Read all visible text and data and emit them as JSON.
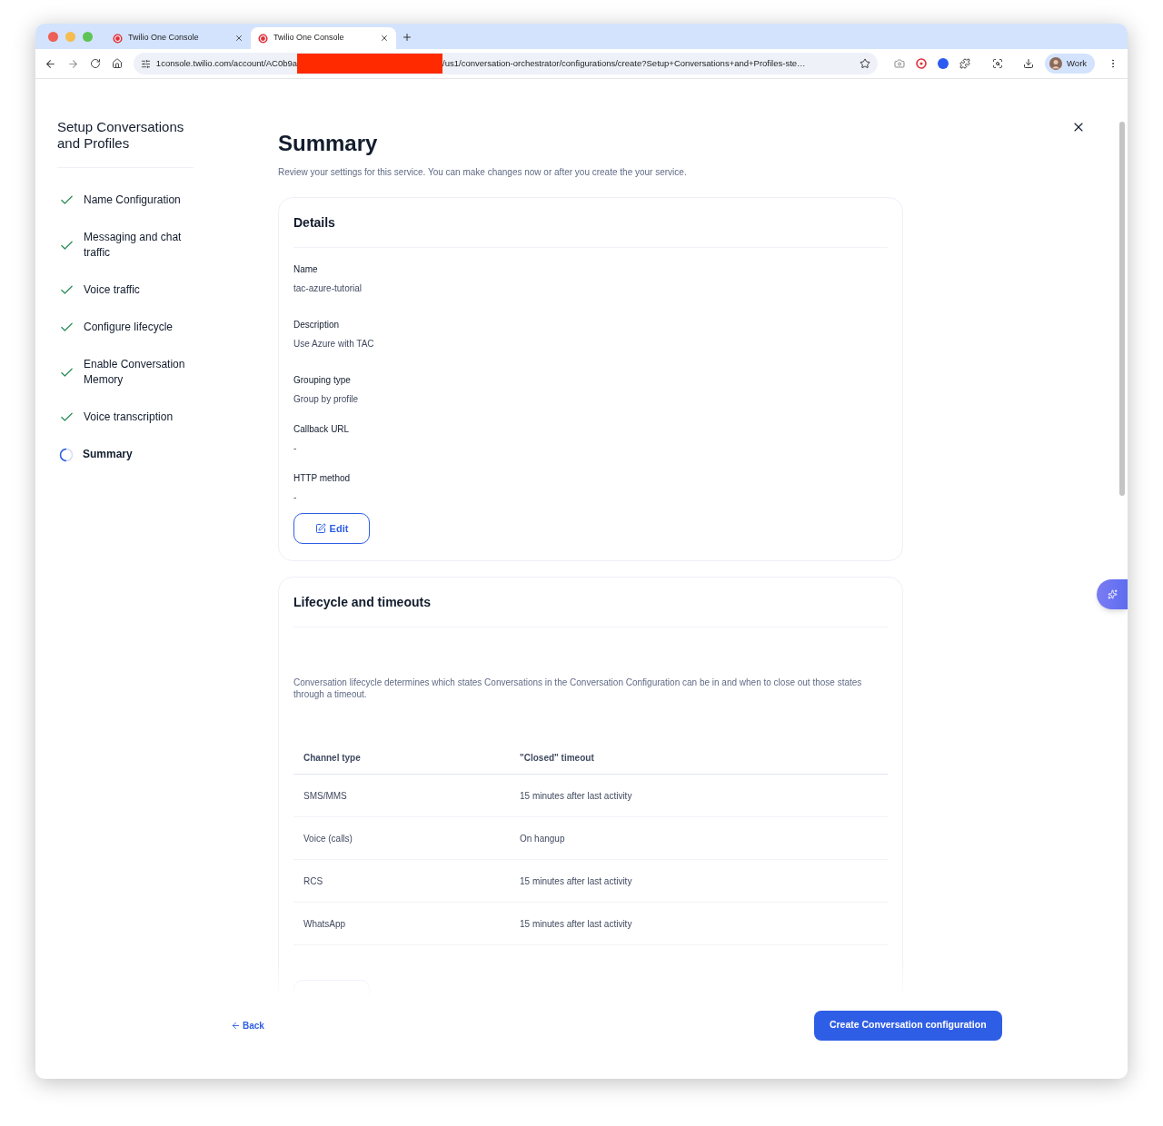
{
  "browser": {
    "tabs": [
      {
        "title": "Twilio One Console",
        "selected": false
      },
      {
        "title": "Twilio One Console",
        "selected": true
      }
    ],
    "address": {
      "before": "1console.twilio.com/account/AC0b9a",
      "after": "/us1/conversation-orchestrator/configurations/create?Setup+Conversations+and+Profiles-ste…"
    },
    "profile": "Work"
  },
  "sidebar": {
    "title": "Setup Conversations and Profiles",
    "steps": [
      {
        "label": "Name Configuration",
        "completed": true,
        "selected": false
      },
      {
        "label": "Messaging and chat traffic",
        "completed": true,
        "selected": false
      },
      {
        "label": "Voice traffic",
        "completed": true,
        "selected": false
      },
      {
        "label": "Configure lifecycle",
        "completed": true,
        "selected": false
      },
      {
        "label": "Enable Conversation Memory",
        "completed": true,
        "selected": false
      },
      {
        "label": "Voice transcription",
        "completed": true,
        "selected": false
      },
      {
        "label": "Summary",
        "completed": false,
        "selected": true
      }
    ]
  },
  "page": {
    "title": "Summary",
    "subtitle": "Review your settings for this service. You can make changes now or after you create the your service."
  },
  "details": {
    "title": "Details",
    "fields": [
      {
        "label": "Name",
        "value": "tac-azure-tutorial"
      },
      {
        "label": "Description",
        "value": "Use Azure with TAC"
      },
      {
        "label": "Grouping type",
        "value": "Group by profile"
      },
      {
        "label": "Callback URL",
        "value": "-"
      },
      {
        "label": "HTTP method",
        "value": "-"
      }
    ],
    "edit": "Edit"
  },
  "lifecycle": {
    "title": "Lifecycle and timeouts",
    "description": "Conversation lifecycle determines which states Conversations in the Conversation Configuration can be in and when to close out those states through a timeout.",
    "table": {
      "columns": [
        "Channel type",
        "\"Closed\" timeout"
      ],
      "rows": [
        [
          "SMS/MMS",
          "15 minutes after last activity"
        ],
        [
          "Voice (calls)",
          "On hangup"
        ],
        [
          "RCS",
          "15 minutes after last activity"
        ],
        [
          "WhatsApp",
          "15 minutes after last activity"
        ]
      ]
    }
  },
  "footer": {
    "back": "Back",
    "create": "Create Conversation configuration"
  }
}
